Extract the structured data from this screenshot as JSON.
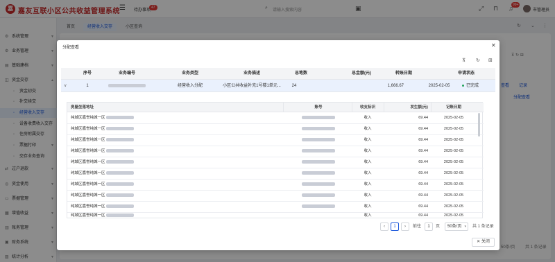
{
  "app": {
    "title": "嘉友互联小区公共收益管理系统",
    "logo_text": "嘉",
    "todo_label": "待办事项",
    "todo_badge": "47",
    "search_placeholder": "请输入搜索内容",
    "notify_badge": "99+",
    "username": "市管理员"
  },
  "sidebar": {
    "items": [
      {
        "label": "系统管理",
        "icon": "gear-icon"
      },
      {
        "label": "业务管理",
        "icon": "gear-icon"
      },
      {
        "label": "基础建档",
        "icon": "folder-icon"
      },
      {
        "label": "资金交存",
        "icon": "wallet-icon"
      },
      {
        "label": "资金初交",
        "icon": "dot-icon"
      },
      {
        "label": "补交续交",
        "icon": "dot-icon"
      },
      {
        "label": "经营收入交存",
        "icon": "dot-icon"
      },
      {
        "label": "设备收费收入交存",
        "icon": "dot-icon"
      },
      {
        "label": "住房附属交存",
        "icon": "dot-icon"
      },
      {
        "label": "票据打印",
        "icon": "dot-icon"
      },
      {
        "label": "交存业务查询",
        "icon": "dot-icon"
      },
      {
        "label": "过户退款",
        "icon": "exchange-icon"
      },
      {
        "label": "资金使用",
        "icon": "coin-icon"
      },
      {
        "label": "票据管理",
        "icon": "ticket-icon"
      },
      {
        "label": "增值收益",
        "icon": "chart-icon"
      },
      {
        "label": "账务管理",
        "icon": "book-icon"
      },
      {
        "label": "财务系统",
        "icon": "calc-icon"
      },
      {
        "label": "统计分析",
        "icon": "stats-icon"
      }
    ]
  },
  "tabs": [
    {
      "label": "首页"
    },
    {
      "label": "经营收入交存"
    },
    {
      "label": "小区查询"
    }
  ],
  "background": {
    "link_1": "查看",
    "link_2": "记录",
    "link_3": "分配查看",
    "pager_select": "50条/页",
    "pager_total": "共 1 条记录"
  },
  "modal": {
    "title": "分配查看",
    "columns": [
      "序号",
      "业务编号",
      "业务类型",
      "业务描述",
      "总笔数",
      "总金额(元)",
      "转账日期",
      "申请状态"
    ],
    "row": {
      "index": "1",
      "business_no": "",
      "type": "经营收入分配",
      "description": "小区公共收益补充1号楼1单元...",
      "count": "24",
      "amount": "1,666.67",
      "date": "2025-02-05",
      "status": "已完成",
      "status_color": "#22a35a"
    },
    "detail_columns": [
      "房屋坐落地址",
      "账号",
      "收支标识",
      "发生额(元)",
      "记账日期"
    ],
    "detail_rows": [
      {
        "address": "纯城区嘉誉纯城一区",
        "direction": "收入",
        "amount": "69.44",
        "date": "2025-02-05"
      },
      {
        "address": "纯城区嘉誉纯城一区",
        "direction": "收入",
        "amount": "69.44",
        "date": "2025-02-05"
      },
      {
        "address": "纯城区嘉誉纯城一区",
        "direction": "收入",
        "amount": "69.44",
        "date": "2025-02-05"
      },
      {
        "address": "纯城区嘉誉纯城一区",
        "direction": "收入",
        "amount": "69.44",
        "date": "2025-02-05"
      },
      {
        "address": "纯城区嘉誉纯城一区",
        "direction": "收入",
        "amount": "69.44",
        "date": "2025-02-05"
      },
      {
        "address": "纯城区嘉誉纯城一区",
        "direction": "收入",
        "amount": "69.44",
        "date": "2025-02-05"
      },
      {
        "address": "纯城区嘉誉纯城一区",
        "direction": "收入",
        "amount": "69.44",
        "date": "2025-02-05"
      },
      {
        "address": "纯城区嘉誉纯城一区",
        "direction": "收入",
        "amount": "69.44",
        "date": "2025-02-05"
      },
      {
        "address": "纯城区嘉誉纯城一区",
        "direction": "收入",
        "amount": "69.44",
        "date": "2025-02-05"
      },
      {
        "address": "纯城区嘉誉纯城一区",
        "direction": "收入",
        "amount": "69.44",
        "date": "2025-02-05"
      }
    ],
    "pager": {
      "current": "1",
      "goto_label": "前往",
      "goto_value": "1",
      "page_unit": "页",
      "page_size": "50条/页",
      "total": "共 1 条记录"
    },
    "close_label": "关闭"
  }
}
